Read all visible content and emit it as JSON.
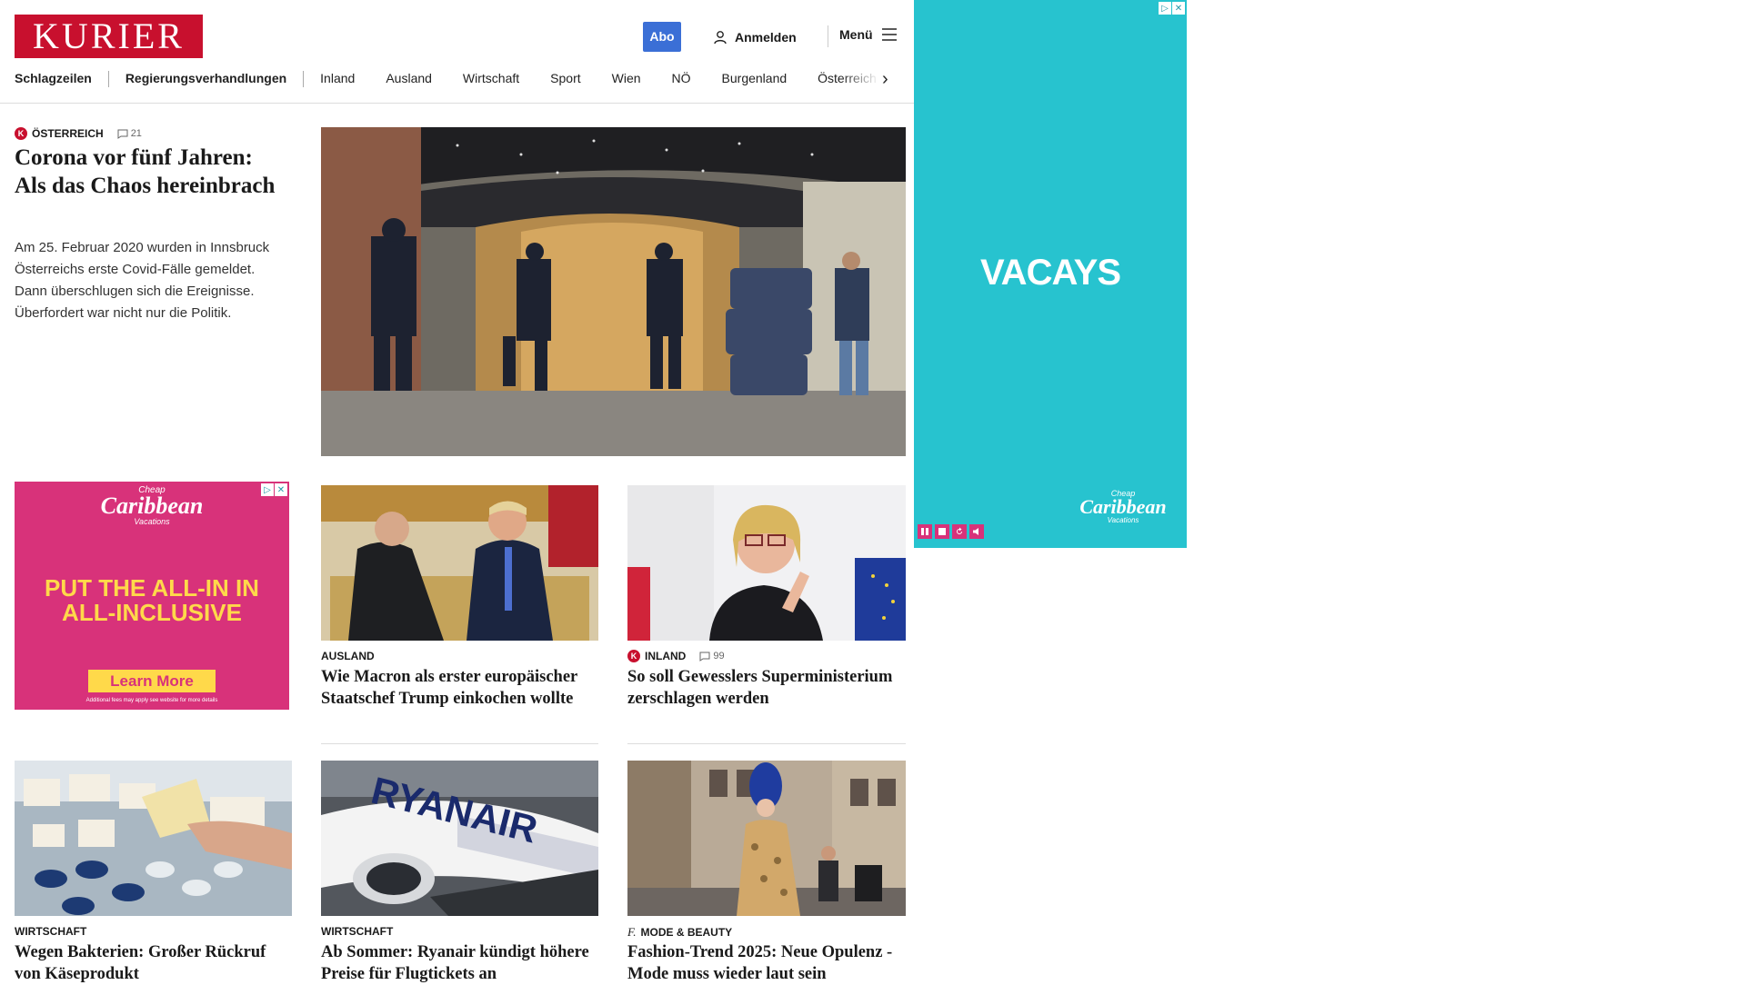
{
  "header": {
    "logo": "KURIER",
    "abo": "Abo",
    "login": "Anmelden",
    "menu": "Menü"
  },
  "nav": {
    "items": [
      "Schlagzeilen",
      "Regierungsverhandlungen",
      "Inland",
      "Ausland",
      "Wirtschaft",
      "Sport",
      "Wien",
      "NÖ",
      "Burgenland",
      "Österreich"
    ]
  },
  "lead": {
    "kicker": "ÖSTERREICH",
    "comments": "21",
    "headline": "Corona vor fünf Jahren: Als das Chaos hereinbrach",
    "teaser": "Am 25. Februar 2020 wurden in Innsbruck Österreichs erste Covid-Fälle gemeldet. Dann überschlugen sich die Ereignisse. Überfordert war nicht nur die Politik."
  },
  "cards": [
    {
      "kicker": "AUSLAND",
      "headline": "Wie Macron als erster europäischer Staatschef Trump einkochen wollte"
    },
    {
      "kicker": "INLAND",
      "comments": "99",
      "headline": "So soll Gewesslers Superministerium zerschlagen werden"
    },
    {
      "kicker": "WIRTSCHAFT",
      "headline": "Wegen Bakterien: Großer Rückruf von Käseprodukt"
    },
    {
      "kicker": "WIRTSCHAFT",
      "headline": "Ab Sommer: Ryanair kündigt höhere Preise für Flugtickets an"
    },
    {
      "kicker": "MODE & BEAUTY",
      "headline": "Fashion-Trend 2025: Neue Opulenz - Mode muss wieder laut sein"
    }
  ],
  "ad_inline": {
    "brand_small": "Cheap",
    "brand": "Caribbean",
    "brand_sub": "Vacations",
    "text": "PUT THE ALL-IN IN ALL-INCLUSIVE",
    "cta": "Learn More",
    "fine": "Additional fees may apply see website for more details"
  },
  "ad_right": {
    "text": "VACAYS",
    "brand_small": "Cheap",
    "brand": "Caribbean",
    "brand_sub": "Vacations"
  },
  "colors": {
    "brand": "#c8102e",
    "abo": "#3b6fd6",
    "ad_pink": "#d8327a",
    "ad_teal": "#27c3cf"
  }
}
